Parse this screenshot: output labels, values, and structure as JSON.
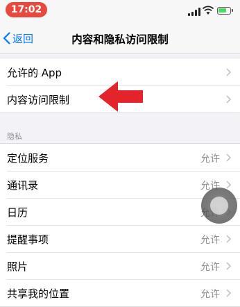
{
  "status_bar": {
    "time": "17:02"
  },
  "nav": {
    "back_label": "返回",
    "title": "内容和隐私访问限制"
  },
  "top_group": [
    {
      "label": "允许的 App"
    },
    {
      "label": "内容访问限制"
    }
  ],
  "privacy": {
    "header": "隐私",
    "items": [
      {
        "label": "定位服务",
        "value": "允许"
      },
      {
        "label": "通讯录",
        "value": "允许"
      },
      {
        "label": "日历",
        "value": "允许"
      },
      {
        "label": "提醒事项",
        "value": "允许"
      },
      {
        "label": "照片",
        "value": "允许"
      },
      {
        "label": "共享我的位置",
        "value": "允许"
      }
    ]
  },
  "colors": {
    "accent": "#007aff",
    "arrow": "#e3242b",
    "time_pill": "#e8493e"
  },
  "icons": [
    "back-chevron-icon",
    "chevron-right-icon",
    "signal-icon",
    "wifi-icon",
    "battery-icon"
  ]
}
